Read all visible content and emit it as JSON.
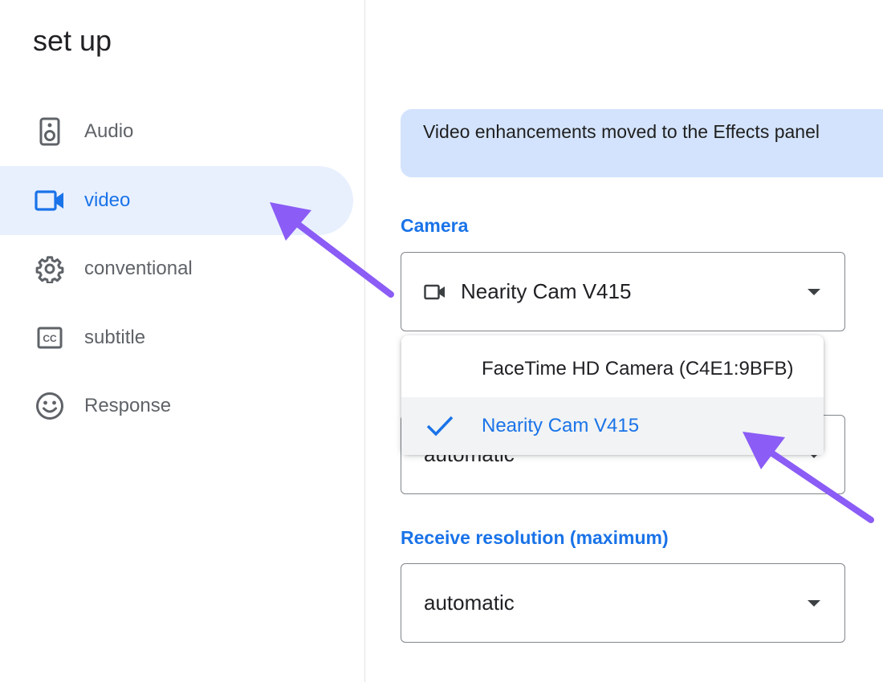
{
  "sidebar": {
    "title": "set up",
    "items": [
      {
        "label": "Audio",
        "icon": "speaker-icon"
      },
      {
        "label": "video",
        "icon": "videocam-icon",
        "active": true
      },
      {
        "label": "conventional",
        "icon": "gear-icon"
      },
      {
        "label": "subtitle",
        "icon": "closed-caption-icon"
      },
      {
        "label": "Response",
        "icon": "smiley-icon"
      }
    ]
  },
  "main": {
    "banner": "Video enhancements moved to the Effects panel",
    "camera": {
      "label": "Camera",
      "selected": "Nearity Cam V415",
      "options": [
        "FaceTime HD Camera (C4E1:9BFB)",
        "Nearity Cam V415"
      ]
    },
    "send_resolution": {
      "value": "automatic"
    },
    "receive_resolution": {
      "label": "Receive resolution (maximum)",
      "value": "automatic"
    }
  },
  "colors": {
    "accent": "#1a73e8",
    "active_bg": "#e8f0fe",
    "banner_bg": "#d3e3fd",
    "annotation_arrow": "#8b5cf6"
  }
}
